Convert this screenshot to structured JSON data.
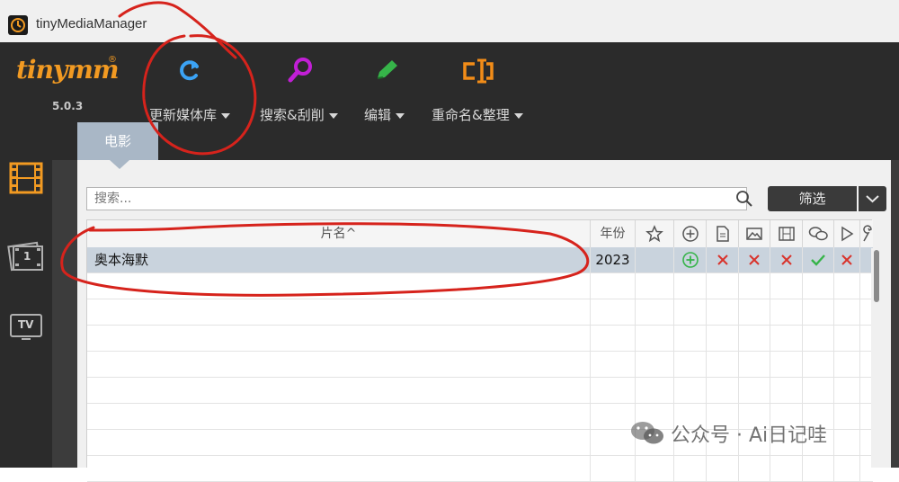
{
  "window": {
    "title": "tinyMediaManager"
  },
  "toolbar": {
    "logo": "tinymm",
    "logo_reg": "®",
    "version": "5.0.3",
    "buttons": [
      {
        "label": "更新媒体库",
        "icon": "refresh-icon",
        "color": "#3ba3f5"
      },
      {
        "label": "搜索&刮削",
        "icon": "magnifier-icon",
        "color": "#c21fd6"
      },
      {
        "label": "编辑",
        "icon": "pencil-icon",
        "color": "#36b449"
      },
      {
        "label": "重命名&整理",
        "icon": "rename-icon",
        "color": "#f28c18"
      }
    ]
  },
  "sidebar": {
    "items": [
      {
        "icon": "movies-icon",
        "color": "#f29a22"
      },
      {
        "icon": "movie-sets-icon",
        "badge": "1"
      },
      {
        "icon": "tv-shows-icon",
        "badge": "TV"
      }
    ]
  },
  "tabs": [
    {
      "label": "电影"
    }
  ],
  "search": {
    "placeholder": "搜索..."
  },
  "filter": {
    "label": "筛选"
  },
  "table": {
    "columns": [
      {
        "label": "片名^"
      },
      {
        "label": "年份"
      },
      {
        "icon": "star-icon"
      },
      {
        "icon": "add-circle-icon"
      },
      {
        "icon": "document-icon"
      },
      {
        "icon": "image-icon"
      },
      {
        "icon": "film-icon"
      },
      {
        "icon": "subtitle-icon"
      },
      {
        "icon": "play-icon"
      },
      {
        "icon": "wrench-icon"
      }
    ],
    "rows": [
      {
        "title": "奥本海默",
        "year": "2023",
        "flags": [
          "",
          "add",
          "x",
          "x",
          "x",
          "check",
          "x",
          ""
        ]
      }
    ]
  },
  "colors": {
    "accent": "#f29a22",
    "ok": "#36b449",
    "missing": "#d8342c",
    "annotation": "#d6231c"
  },
  "watermark": {
    "text": "公众号 · Ai日记哇"
  }
}
